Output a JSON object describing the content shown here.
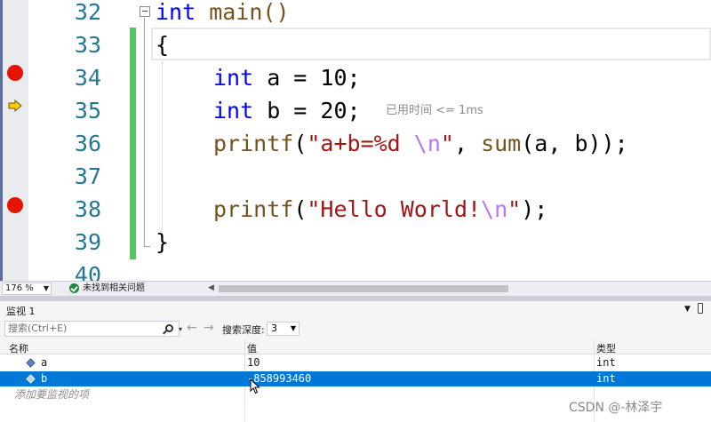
{
  "editor": {
    "lines": [
      {
        "no": "32",
        "breakpoint": false,
        "current": false
      },
      {
        "no": "33",
        "breakpoint": false,
        "current": false
      },
      {
        "no": "34",
        "breakpoint": true,
        "current": false
      },
      {
        "no": "35",
        "breakpoint": false,
        "current": true
      },
      {
        "no": "36",
        "breakpoint": false,
        "current": false
      },
      {
        "no": "37",
        "breakpoint": false,
        "current": false
      },
      {
        "no": "38",
        "breakpoint": true,
        "current": false
      },
      {
        "no": "39",
        "breakpoint": false,
        "current": false
      },
      {
        "no": "40",
        "breakpoint": false,
        "current": false
      }
    ],
    "code": {
      "l32_kw": "int",
      "l32_fn": " main()",
      "l33": "{",
      "l34_kw": "int",
      "l34_rest": " a = 10;",
      "l35_kw": "int",
      "l35_rest": " b = 20;",
      "l35_perf": "已用时间 <= 1ms",
      "l36_fn": "printf",
      "l36_p1": "(",
      "l36_str": "\"a+b=%d ",
      "l36_esc": "\\n",
      "l36_str2": "\"",
      "l36_p2": ", ",
      "l36_fn2": "sum",
      "l36_rest": "(a, b));",
      "l38_fn": "printf",
      "l38_p1": "(",
      "l38_str": "\"Hello World!",
      "l38_esc": "\\n",
      "l38_str2": "\"",
      "l38_rest": ");",
      "l39": "}"
    },
    "colors": {
      "keyword": "#0000ff",
      "function": "#74531f",
      "string": "#a31515",
      "escape": "#b776fb",
      "line_number": "#237893",
      "breakpoint": "#e51400",
      "change_bar": "#57c561"
    }
  },
  "status": {
    "zoom": "176 %",
    "issues": "未找到相关问题"
  },
  "watch": {
    "title": "监视 1",
    "search_placeholder": "搜索(Ctrl+E)",
    "depth_label": "搜索深度:",
    "depth_value": "3",
    "columns": {
      "name": "名称",
      "value": "值",
      "type": "类型"
    },
    "rows": [
      {
        "name": "a",
        "value": "10",
        "type": "int",
        "selected": false
      },
      {
        "name": "b",
        "value": "-858993460",
        "type": "int",
        "selected": true
      }
    ],
    "add_placeholder": "添加要监视的项",
    "selection_color": "#0078d7"
  },
  "watermark": "CSDN @-林泽宇"
}
